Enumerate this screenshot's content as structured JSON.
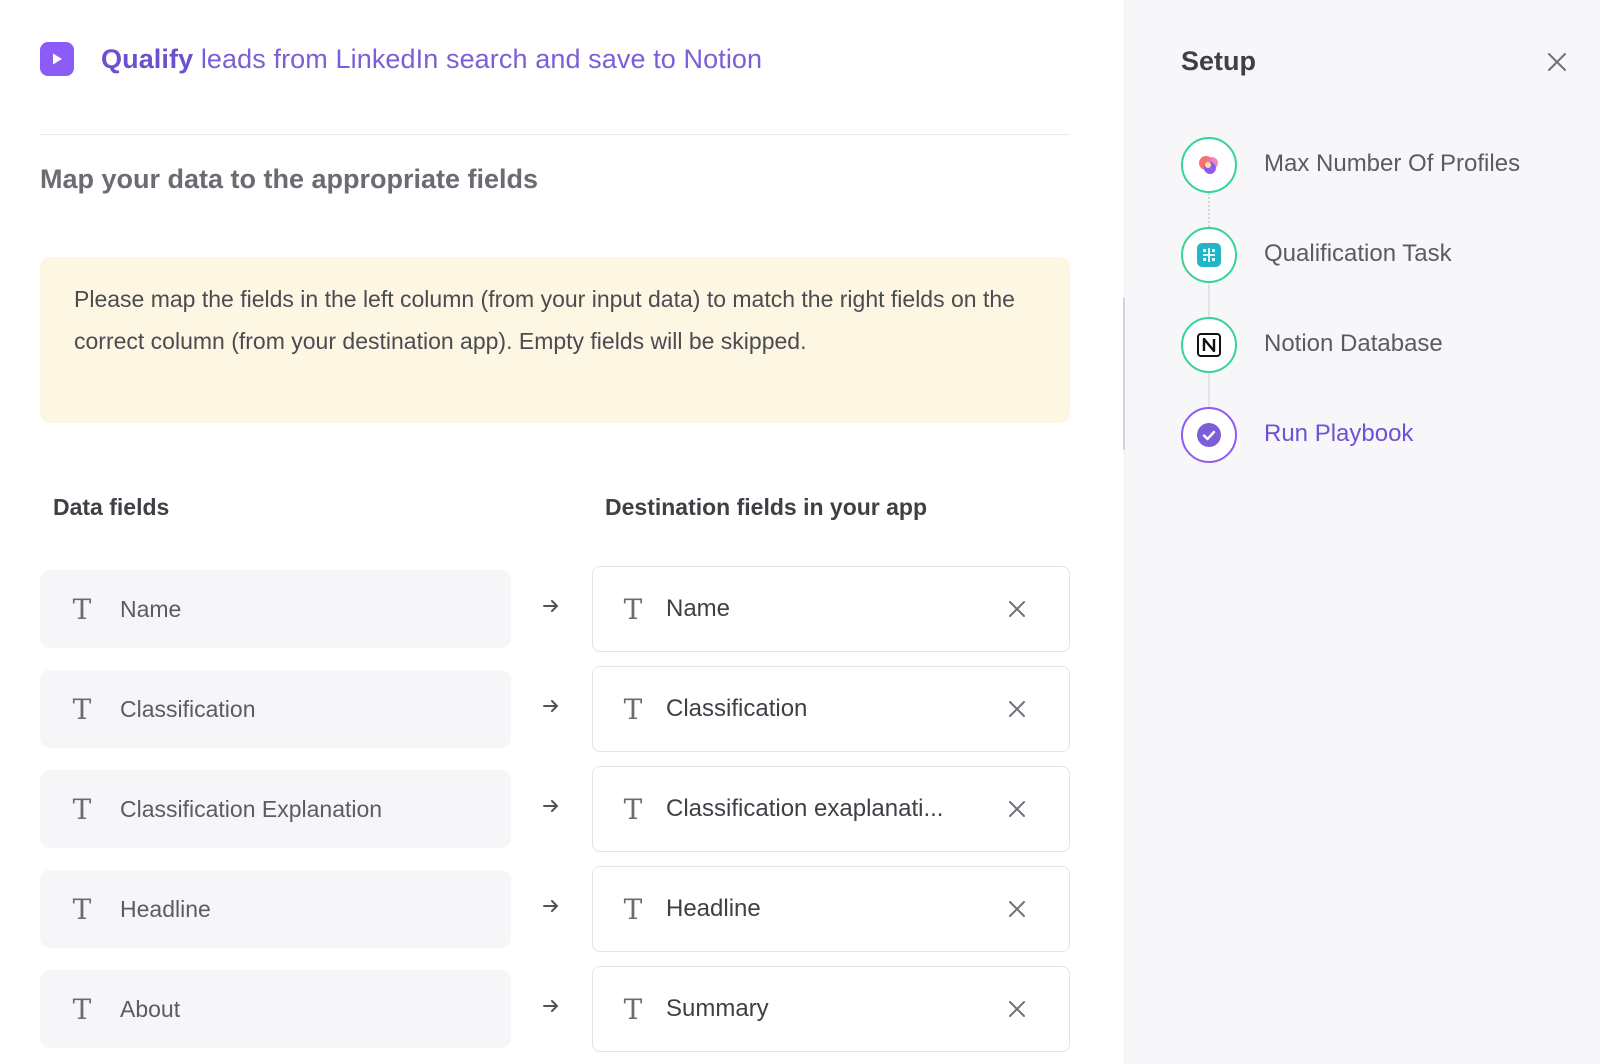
{
  "header": {
    "title_bold": "Qualify",
    "title_rest": " leads from LinkedIn search and save to Notion"
  },
  "section_title": "Map your data to the appropriate fields",
  "notice": "Please map the fields in the left column (from your input data) to match the right fields on the correct column (from your destination app). Empty fields will be skipped.",
  "columns": {
    "left": "Data fields",
    "right": "Destination fields in your app"
  },
  "mappings": [
    {
      "source": "Name",
      "destination": "Name"
    },
    {
      "source": "Classification",
      "destination": "Classification"
    },
    {
      "source": "Classification Explanation",
      "destination": "Classification exaplanati..."
    },
    {
      "source": "Headline",
      "destination": "Headline"
    },
    {
      "source": "About",
      "destination": "Summary"
    }
  ],
  "sidebar": {
    "title": "Setup",
    "steps": [
      {
        "label": "Max Number Of Profiles",
        "icon": "profiles-icon",
        "status": "complete"
      },
      {
        "label": "Qualification Task",
        "icon": "task-grid-icon",
        "status": "complete"
      },
      {
        "label": "Notion Database",
        "icon": "notion-icon",
        "status": "complete"
      },
      {
        "label": "Run Playbook",
        "icon": "check-circle-icon",
        "status": "current"
      }
    ]
  },
  "colors": {
    "accent": "#7c5fd6",
    "complete": "#34d399",
    "notice_bg": "#fdf6e3"
  }
}
